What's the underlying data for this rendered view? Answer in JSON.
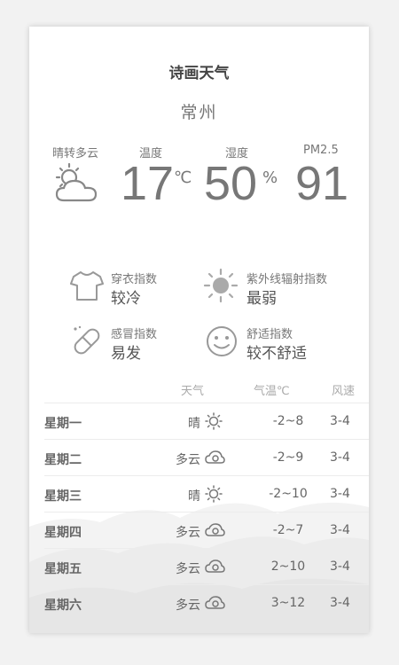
{
  "app": {
    "title": "诗画天气",
    "city": "常州"
  },
  "current": {
    "condition": "晴转多云",
    "condition_icon": "partly-cloudy-icon",
    "temperature_label": "温度",
    "temperature": "17",
    "temperature_unit": "℃",
    "humidity_label": "湿度",
    "humidity": "50",
    "humidity_unit": "%",
    "pm25_label": "PM2.5",
    "pm25": "91"
  },
  "indices": [
    {
      "icon": "shirt-icon",
      "label": "穿衣指数",
      "value": "较冷"
    },
    {
      "icon": "sun-icon",
      "label": "紫外线辐射指数",
      "value": "最弱"
    },
    {
      "icon": "pill-icon",
      "label": "感冒指数",
      "value": "易发"
    },
    {
      "icon": "smiley-icon",
      "label": "舒适指数",
      "value": "较不舒适"
    }
  ],
  "forecast": {
    "headers": {
      "weather": "天气",
      "temp": "气温℃",
      "wind": "风速"
    },
    "days": [
      {
        "day": "星期一",
        "weather": "晴",
        "icon": "sun-icon",
        "temp": "-2~8",
        "wind": "3-4"
      },
      {
        "day": "星期二",
        "weather": "多云",
        "icon": "cloud-icon",
        "temp": "-2~9",
        "wind": "3-4"
      },
      {
        "day": "星期三",
        "weather": "晴",
        "icon": "sun-icon",
        "temp": "-2~10",
        "wind": "3-4"
      },
      {
        "day": "星期四",
        "weather": "多云",
        "icon": "cloud-icon",
        "temp": "-2~7",
        "wind": "3-4"
      },
      {
        "day": "星期五",
        "weather": "多云",
        "icon": "cloud-icon",
        "temp": "2~10",
        "wind": "3-4"
      },
      {
        "day": "星期六",
        "weather": "多云",
        "icon": "cloud-icon",
        "temp": "3~12",
        "wind": "3-4"
      }
    ]
  }
}
